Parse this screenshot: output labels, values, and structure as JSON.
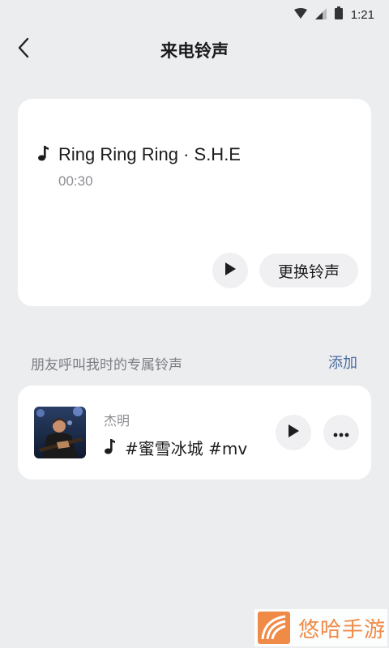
{
  "status_bar": {
    "time": "1:21",
    "icons": [
      "wifi-icon",
      "signal-icon",
      "battery-icon"
    ]
  },
  "header": {
    "title": "来电铃声",
    "back_icon": "chevron-left-icon"
  },
  "current_ringtone": {
    "name": "Ring Ring Ring · S.H.E",
    "duration": "00:30",
    "change_label": "更换铃声",
    "icons": [
      "music-note-icon",
      "play-icon"
    ]
  },
  "friends_section": {
    "label": "朋友呼叫我时的专属铃声",
    "add_label": "添加",
    "items": [
      {
        "contact": "杰明",
        "ringtone": "#蜜雪冰城 #mv",
        "icons": [
          "music-note-icon",
          "play-icon",
          "more-icon"
        ]
      }
    ]
  },
  "watermark": {
    "text": "悠哈手游"
  },
  "colors": {
    "background": "#ecedef",
    "card": "#ffffff",
    "button": "#f0f0f2",
    "accent_link": "#4b6ba3",
    "watermark": "#f08a47"
  }
}
